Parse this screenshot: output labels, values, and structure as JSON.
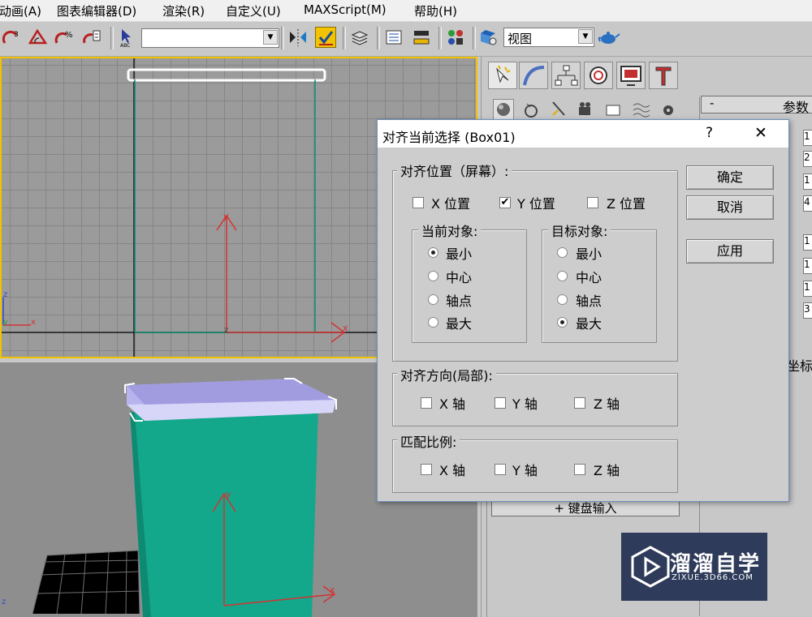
{
  "menubar": {
    "items": [
      "动画(A)",
      "图表编辑器(D)",
      "渲染(R)",
      "自定义(U)",
      "MAXScript(M)",
      "帮助(H)"
    ]
  },
  "toolbar": {
    "selection_set_value": "",
    "viewport_label": "视图"
  },
  "command_panel": {
    "rollout_collapse": "-",
    "rollout_title": "参数",
    "keyboard_entry_rollout": "+ 键盘输入",
    "coord_label": "坐标",
    "spinner_values": [
      "1",
      "2",
      "1",
      "4",
      "1",
      "1",
      "1",
      "3"
    ]
  },
  "viewport": {
    "axis_x": "x",
    "axis_y": "y",
    "axis_z": "z"
  },
  "dialog": {
    "title": "对齐当前选择 (Box01)",
    "help_label": "?",
    "close_label": "✕",
    "align_position": {
      "label": "对齐位置（屏幕）:",
      "x": {
        "label": "X 位置",
        "checked": false
      },
      "y": {
        "label": "Y 位置",
        "checked": true
      },
      "z": {
        "label": "Z 位置",
        "checked": false
      }
    },
    "current_object": {
      "label": "当前对象:",
      "options": [
        "最小",
        "中心",
        "轴点",
        "最大"
      ],
      "selected": "最小"
    },
    "target_object": {
      "label": "目标对象:",
      "options": [
        "最小",
        "中心",
        "轴点",
        "最大"
      ],
      "selected": "最大"
    },
    "align_orientation": {
      "label": "对齐方向(局部):",
      "x": "X 轴",
      "y": "Y 轴",
      "z": "Z 轴"
    },
    "match_scale": {
      "label": "匹配比例:",
      "x": "X 轴",
      "y": "Y 轴",
      "z": "Z 轴"
    },
    "buttons": {
      "ok": "确定",
      "cancel": "取消",
      "apply": "应用"
    }
  },
  "watermark": {
    "brand": "溜溜自学",
    "url": "ZIXUE.3D66.COM"
  },
  "colors": {
    "viewport_active_border": "#f2c300",
    "box_front": "#13a88b",
    "box_top": "#b7b3ef",
    "gizmo_red": "#d43232",
    "watermark_bg": "#2f3b5a"
  }
}
